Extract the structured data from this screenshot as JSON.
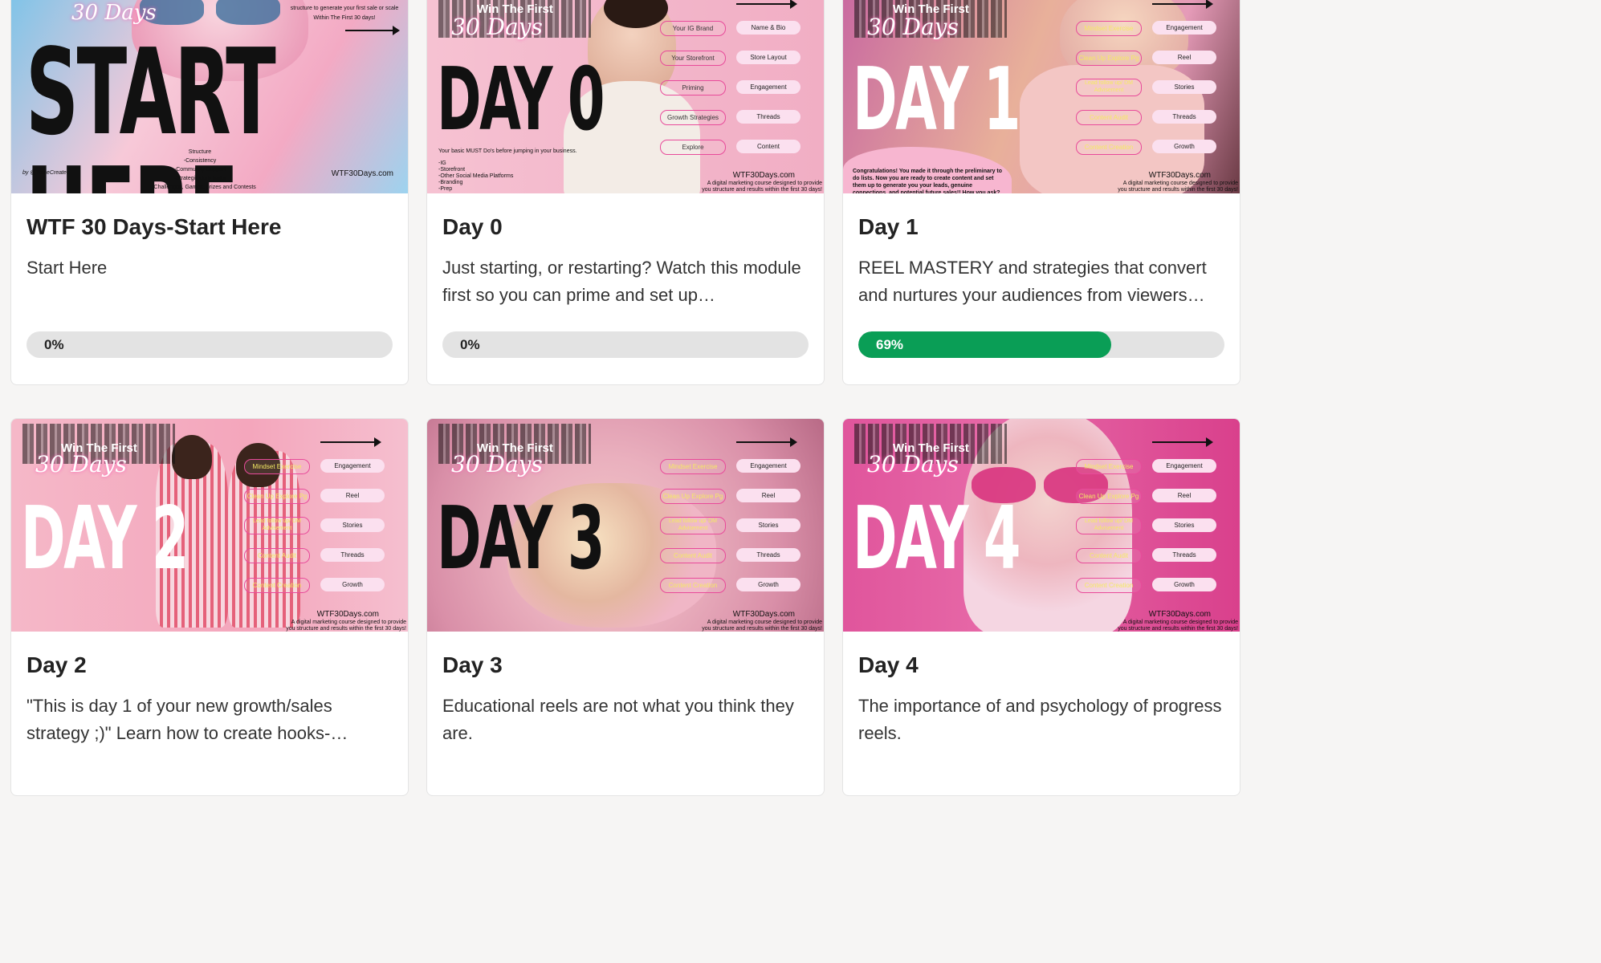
{
  "cards": [
    {
      "title": "WTF 30 Days-Start Here",
      "desc": "Start Here",
      "progress": "0%",
      "progress_value": 0,
      "thumb": {
        "headline": "START HERE",
        "lines": [
          "structure to generate your first sale or scale",
          "Within The First 30 days!",
          "Structure",
          "-Consistency",
          "-Community Support",
          "-Strategic daily tasks",
          "-Challenges, Games, prizes and Contests"
        ],
        "site": "WTF30Days.com",
        "byline": "by @TraceCreates"
      }
    },
    {
      "title": "Day 0",
      "desc": "Just starting, or restarting? Watch this module first so you can prime and set up…",
      "progress": "0%",
      "progress_value": 0,
      "thumb": {
        "headline": "DAY 0",
        "banner": "Win The First",
        "script": "30 Days",
        "left_pills": [
          "Your IG Brand",
          "Your Storefront",
          "Priming",
          "Growth Strategies",
          "Explore"
        ],
        "right_pills": [
          "Name & Bio",
          "Store Layout",
          "Engagement",
          "Threads",
          "Content"
        ],
        "lines": [
          "Your basic MUST Do's before jumping in your business.",
          "-IG",
          "-Storefront",
          "-Other Social Media Platforms",
          "-Branding",
          "-Prep"
        ],
        "site": "WTF30Days.com",
        "tagline": "A digital marketing course designed to provide you structure and results within the first 30 days!"
      }
    },
    {
      "title": "Day 1",
      "desc": "REEL MASTERY and strategies that convert and nurtures your audiences from viewers…",
      "progress": "69%",
      "progress_value": 69,
      "thumb": {
        "headline": "DAY 1",
        "banner": "Win The First",
        "script": "30 Days",
        "left_pills": [
          "Mindset Exercise",
          "Clean Up Explore Pg",
          "Lead follow up/ DM Advisement",
          "Content Audit",
          "Content Creation"
        ],
        "right_pills": [
          "Engagement",
          "Reel",
          "Stories",
          "Threads",
          "Growth"
        ],
        "lines": [
          "Congratulations! You made it through the preliminary to do lists. Now you are ready to create content and set them up to generate you your leads, genuine connections, and potential future sales!! How you ask?"
        ],
        "site": "WTF30Days.com",
        "tagline": "A digital marketing course designed to provide you structure and results within the first 30 days!"
      }
    },
    {
      "title": "Day 2",
      "desc": "\"This is day 1 of your new growth/sales strategy ;)\" Learn how to create hooks-…",
      "progress": "",
      "progress_value": 0,
      "thumb": {
        "headline": "DAY 2",
        "banner": "Win The First",
        "script": "30 Days",
        "left_pills": [
          "Mindset Exercise",
          "Clean Up Explore Pg",
          "Lead follow up/ DM Advisement",
          "Content Audit",
          "Content Creation"
        ],
        "right_pills": [
          "Engagement",
          "Reel",
          "Stories",
          "Threads",
          "Growth"
        ],
        "site": "WTF30Days.com",
        "tagline": "A digital marketing course designed to provide you structure and results within the first 30 days!"
      }
    },
    {
      "title": "Day 3",
      "desc": "Educational reels are not what you think they are.",
      "progress": "",
      "progress_value": 0,
      "thumb": {
        "headline": "DAY 3",
        "banner": "Win The First",
        "script": "30 Days",
        "left_pills": [
          "Mindset Exercise",
          "Clean Up Explore Pg",
          "Lead follow up/ DM Advisement",
          "Content Audit",
          "Content Creation"
        ],
        "right_pills": [
          "Engagement",
          "Reel",
          "Stories",
          "Threads",
          "Growth"
        ],
        "site": "WTF30Days.com",
        "tagline": "A digital marketing course designed to provide you structure and results within the first 30 days!"
      }
    },
    {
      "title": "Day 4",
      "desc": "The importance of and psychology of progress reels.",
      "progress": "",
      "progress_value": 0,
      "thumb": {
        "headline": "DAY 4",
        "banner": "Win The First",
        "script": "30 Days",
        "left_pills": [
          "Mindset Exercise",
          "Clean Up Explore Pg",
          "Lead follow up/ DM Advisement",
          "Content Audit",
          "Content Creation"
        ],
        "right_pills": [
          "Engagement",
          "Reel",
          "Stories",
          "Threads",
          "Growth"
        ],
        "site": "WTF30Days.com",
        "tagline": "A digital marketing course designed to provide you structure and results within the first 30 days!"
      }
    }
  ],
  "colors": {
    "progress_fill": "#0a9e56",
    "progress_track": "#e3e3e3",
    "card_bg": "#ffffff",
    "page_bg": "#f6f5f4"
  }
}
